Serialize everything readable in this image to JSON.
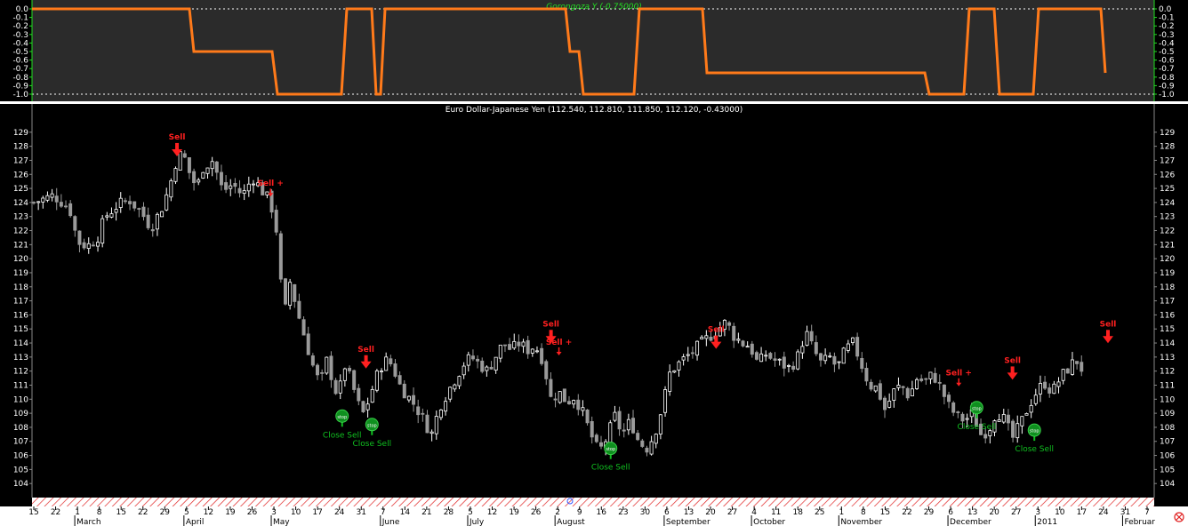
{
  "indicator": {
    "title": "Gorongoza Y (-0.75000)",
    "yticks": [
      "0.0",
      "-0.1",
      "-0.2",
      "-0.3",
      "-0.4",
      "-0.5",
      "-0.6",
      "-0.7",
      "-0.8",
      "-0.9",
      "-1.0"
    ],
    "ylim": [
      -1.0,
      0.0
    ],
    "line_color": "#ff7a1a",
    "label_color": "#22dd22"
  },
  "chart_data": {
    "type": "candlestick",
    "title": "Euro Dollar-Japanese Yen (112.540, 112.810, 111.850, 112.120, -0.43000)",
    "ylim": [
      103,
      130
    ],
    "yticks": [
      129,
      128,
      127,
      126,
      125,
      124,
      123,
      122,
      121,
      120,
      119,
      118,
      117,
      116,
      115,
      114,
      113,
      112,
      111,
      110,
      109,
      108,
      107,
      106,
      105,
      104
    ],
    "close_series": [
      {
        "d": 0,
        "v": 124.0
      },
      {
        "d": 10,
        "v": 124.5
      },
      {
        "d": 18,
        "v": 123.6
      },
      {
        "d": 22,
        "v": 121.2
      },
      {
        "d": 27,
        "v": 120.9
      },
      {
        "d": 32,
        "v": 121.5
      },
      {
        "d": 36,
        "v": 123.0
      },
      {
        "d": 42,
        "v": 123.8
      },
      {
        "d": 48,
        "v": 124.2
      },
      {
        "d": 54,
        "v": 123.3
      },
      {
        "d": 59,
        "v": 122.2
      },
      {
        "d": 64,
        "v": 123.5
      },
      {
        "d": 68,
        "v": 125.0
      },
      {
        "d": 72,
        "v": 127.2
      },
      {
        "d": 75,
        "v": 127.5
      },
      {
        "d": 78,
        "v": 126.2
      },
      {
        "d": 82,
        "v": 125.0
      },
      {
        "d": 85,
        "v": 126.5
      },
      {
        "d": 90,
        "v": 127.0
      },
      {
        "d": 95,
        "v": 124.8
      },
      {
        "d": 100,
        "v": 125.3
      },
      {
        "d": 105,
        "v": 124.5
      },
      {
        "d": 110,
        "v": 125.8
      },
      {
        "d": 115,
        "v": 124.8
      },
      {
        "d": 119,
        "v": 124.0
      },
      {
        "d": 122,
        "v": 122.0
      },
      {
        "d": 124,
        "v": 118.5
      },
      {
        "d": 126,
        "v": 116.0
      },
      {
        "d": 129,
        "v": 118.5
      },
      {
        "d": 132,
        "v": 116.5
      },
      {
        "d": 136,
        "v": 114.5
      },
      {
        "d": 140,
        "v": 112.5
      },
      {
        "d": 144,
        "v": 111.0
      },
      {
        "d": 147,
        "v": 112.8
      },
      {
        "d": 150,
        "v": 111.5
      },
      {
        "d": 153,
        "v": 110.0
      },
      {
        "d": 156,
        "v": 112.5
      },
      {
        "d": 159,
        "v": 111.5
      },
      {
        "d": 162,
        "v": 110.2
      },
      {
        "d": 165,
        "v": 108.8
      },
      {
        "d": 168,
        "v": 109.8
      },
      {
        "d": 172,
        "v": 111.5
      },
      {
        "d": 176,
        "v": 112.8
      },
      {
        "d": 180,
        "v": 112.5
      },
      {
        "d": 184,
        "v": 111.0
      },
      {
        "d": 188,
        "v": 110.2
      },
      {
        "d": 192,
        "v": 109.5
      },
      {
        "d": 196,
        "v": 108.5
      },
      {
        "d": 200,
        "v": 107.5
      },
      {
        "d": 204,
        "v": 109.5
      },
      {
        "d": 208,
        "v": 110.5
      },
      {
        "d": 212,
        "v": 111.5
      },
      {
        "d": 216,
        "v": 112.5
      },
      {
        "d": 220,
        "v": 113.0
      },
      {
        "d": 224,
        "v": 112.5
      },
      {
        "d": 228,
        "v": 112.0
      },
      {
        "d": 232,
        "v": 113.0
      },
      {
        "d": 236,
        "v": 114.0
      },
      {
        "d": 240,
        "v": 113.5
      },
      {
        "d": 244,
        "v": 114.0
      },
      {
        "d": 248,
        "v": 113.5
      },
      {
        "d": 252,
        "v": 113.8
      },
      {
        "d": 256,
        "v": 112.8
      },
      {
        "d": 260,
        "v": 110.0
      },
      {
        "d": 264,
        "v": 110.5
      },
      {
        "d": 268,
        "v": 109.8
      },
      {
        "d": 272,
        "v": 110.2
      },
      {
        "d": 276,
        "v": 109.0
      },
      {
        "d": 280,
        "v": 107.5
      },
      {
        "d": 284,
        "v": 106.2
      },
      {
        "d": 288,
        "v": 107.2
      },
      {
        "d": 292,
        "v": 108.8
      },
      {
        "d": 296,
        "v": 107.5
      },
      {
        "d": 300,
        "v": 108.5
      },
      {
        "d": 304,
        "v": 107.0
      },
      {
        "d": 308,
        "v": 106.5
      },
      {
        "d": 312,
        "v": 107.5
      },
      {
        "d": 316,
        "v": 109.5
      },
      {
        "d": 320,
        "v": 112.0
      },
      {
        "d": 324,
        "v": 112.5
      },
      {
        "d": 328,
        "v": 113.0
      },
      {
        "d": 332,
        "v": 113.5
      },
      {
        "d": 336,
        "v": 114.0
      },
      {
        "d": 340,
        "v": 114.5
      },
      {
        "d": 344,
        "v": 115.0
      },
      {
        "d": 348,
        "v": 115.5
      },
      {
        "d": 352,
        "v": 114.5
      },
      {
        "d": 356,
        "v": 114.0
      },
      {
        "d": 360,
        "v": 113.8
      },
      {
        "d": 364,
        "v": 112.5
      },
      {
        "d": 368,
        "v": 113.2
      },
      {
        "d": 372,
        "v": 112.8
      },
      {
        "d": 376,
        "v": 112.5
      },
      {
        "d": 380,
        "v": 112.2
      },
      {
        "d": 384,
        "v": 113.0
      },
      {
        "d": 388,
        "v": 114.8
      },
      {
        "d": 392,
        "v": 113.5
      },
      {
        "d": 396,
        "v": 112.5
      },
      {
        "d": 400,
        "v": 113.0
      },
      {
        "d": 404,
        "v": 112.2
      },
      {
        "d": 408,
        "v": 113.5
      },
      {
        "d": 412,
        "v": 114.0
      },
      {
        "d": 416,
        "v": 112.5
      },
      {
        "d": 420,
        "v": 111.0
      },
      {
        "d": 424,
        "v": 110.8
      },
      {
        "d": 428,
        "v": 109.2
      },
      {
        "d": 432,
        "v": 110.5
      },
      {
        "d": 436,
        "v": 111.0
      },
      {
        "d": 440,
        "v": 110.2
      },
      {
        "d": 444,
        "v": 111.5
      },
      {
        "d": 448,
        "v": 111.2
      },
      {
        "d": 452,
        "v": 111.8
      },
      {
        "d": 456,
        "v": 110.8
      },
      {
        "d": 460,
        "v": 109.5
      },
      {
        "d": 464,
        "v": 108.8
      },
      {
        "d": 468,
        "v": 108.5
      },
      {
        "d": 472,
        "v": 109.0
      },
      {
        "d": 476,
        "v": 107.5
      },
      {
        "d": 480,
        "v": 107.8
      },
      {
        "d": 484,
        "v": 109.2
      },
      {
        "d": 488,
        "v": 108.5
      },
      {
        "d": 492,
        "v": 107.2
      },
      {
        "d": 496,
        "v": 108.2
      },
      {
        "d": 500,
        "v": 109.5
      },
      {
        "d": 504,
        "v": 110.5
      },
      {
        "d": 508,
        "v": 111.2
      },
      {
        "d": 512,
        "v": 110.5
      },
      {
        "d": 516,
        "v": 111.5
      },
      {
        "d": 520,
        "v": 112.2
      },
      {
        "d": 524,
        "v": 112.8
      },
      {
        "d": 527,
        "v": 112.12
      }
    ],
    "signals": [
      {
        "label": "Sell",
        "kind": "sell",
        "d": 72,
        "v": 127.6
      },
      {
        "label": "Sell +",
        "kind": "sellplus",
        "d": 119,
        "v": 124.8
      },
      {
        "label": "Sell",
        "kind": "sell",
        "d": 167,
        "v": 112.5
      },
      {
        "label": "Sell",
        "kind": "sell",
        "d": 260,
        "v": 114.3
      },
      {
        "label": "Sell +",
        "kind": "sellplus",
        "d": 264,
        "v": 113.5
      },
      {
        "label": "Sell",
        "kind": "sell",
        "d": 343,
        "v": 113.9
      },
      {
        "label": "Sell +",
        "kind": "sellplus",
        "d": 465,
        "v": 111.3
      },
      {
        "label": "Sell",
        "kind": "sell",
        "d": 492,
        "v": 111.7
      },
      {
        "label": "Sell",
        "kind": "sell",
        "d": 540,
        "v": 114.3
      },
      {
        "label": "Close Sell",
        "kind": "close",
        "d": 155,
        "v": 108.8
      },
      {
        "label": "Close Sell",
        "kind": "close",
        "d": 170,
        "v": 108.2
      },
      {
        "label": "Close Sell",
        "kind": "close",
        "d": 290,
        "v": 106.5
      },
      {
        "label": "Close Sell",
        "kind": "close",
        "d": 474,
        "v": 109.4
      },
      {
        "label": "Close Sell",
        "kind": "close",
        "d": 503,
        "v": 107.8
      }
    ],
    "date_ticks": [
      "15",
      "22",
      "1",
      "8",
      "15",
      "22",
      "29",
      "5",
      "12",
      "19",
      "26",
      "3",
      "10",
      "17",
      "24",
      "31",
      "7",
      "14",
      "21",
      "28",
      "5",
      "12",
      "19",
      "26",
      "2",
      "9",
      "16",
      "23",
      "30",
      "6",
      "13",
      "20",
      "27",
      "4",
      "11",
      "18",
      "25",
      "1",
      "8",
      "15",
      "22",
      "29",
      "6",
      "13",
      "20",
      "27",
      "3",
      "10",
      "17",
      "24",
      "31",
      "7"
    ],
    "month_labels": [
      "March",
      "April",
      "May",
      "June",
      "July",
      "August",
      "September",
      "October",
      "November",
      "December",
      "2011",
      "Februar"
    ]
  }
}
